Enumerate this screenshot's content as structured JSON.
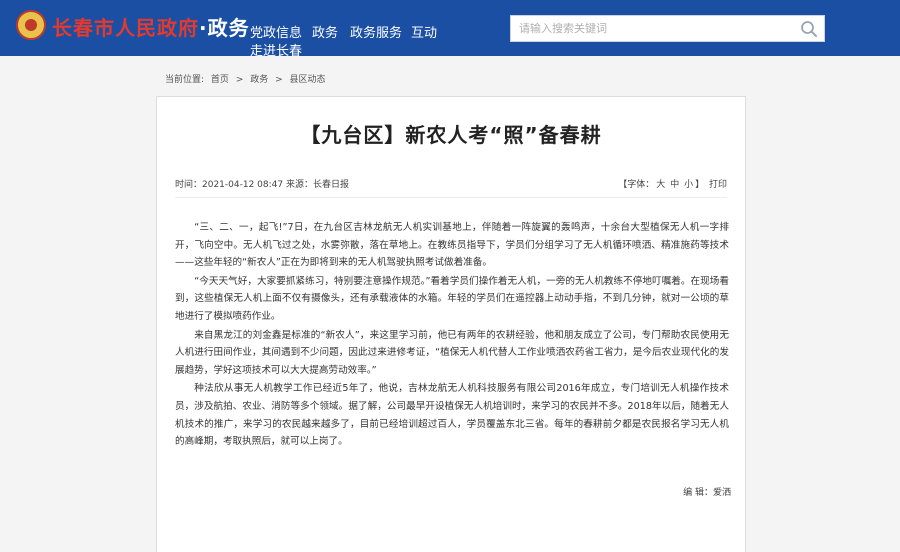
{
  "header": {
    "site_title": "长春市人民政府",
    "separator": "·",
    "subtitle": "政务",
    "nav_items": [
      "党政信息",
      "政务",
      "政务服务",
      "互动"
    ],
    "nav_second_line": "走进长春",
    "search_placeholder": "请输入搜索关键词",
    "icons": {
      "emblem": "national-emblem-icon",
      "search": "search-icon"
    },
    "colors": {
      "header_bg": "#1b4fa3",
      "title_red": "#e23a2e"
    }
  },
  "breadcrumb": {
    "label": "当前位置:",
    "items": [
      "首页",
      "政务",
      "县区动态"
    ],
    "sep": ">"
  },
  "article": {
    "title": "【九台区】新农人考“照”备春耕",
    "time": "时间：2021-04-12 08:47",
    "source": "来源：长春日报",
    "font_label": "【字体：",
    "font_sizes": [
      "大",
      "中",
      "小"
    ],
    "font_close": "】",
    "print_label": "打印",
    "paragraphs": [
      "“三、二、一，起飞!”7日，在九台区吉林龙航无人机实训基地上，伴随着一阵旋翼的轰鸣声，十余台大型植保无人机一字排开，飞向空中。无人机飞过之处，水雾弥散，落在草地上。在教练员指导下，学员们分组学习了无人机循环喷洒、精准施药等技术——这些年轻的“新农人”正在为即将到来的无人机驾驶执照考试做着准备。",
      "“今天天气好，大家要抓紧练习，特别要注意操作规范。”看着学员们操作着无人机，一旁的无人机教练不停地叮嘱着。在现场看到，这些植保无人机上面不仅有摄像头，还有承载液体的水箱。年轻的学员们在遥控器上动动手指，不到几分钟，就对一公顷的草地进行了模拟喷药作业。",
      "来自黑龙江的刘金鑫是标准的“新农人”，来这里学习前，他已有两年的农耕经验，他和朋友成立了公司，专门帮助农民使用无人机进行田间作业，其间遇到不少问题，因此过来进修考证，“植保无人机代替人工作业喷洒农药省工省力，是今后农业现代化的发展趋势，学好这项技术可以大大提高劳动效率。”",
      "种法欣从事无人机教学工作已经近5年了，他说，吉林龙航无人机科技服务有限公司2016年成立，专门培训无人机操作技术员，涉及航拍、农业、消防等多个领域。据了解，公司最早开设植保无人机培训时，来学习的农民并不多。2018年以后，随着无人机技术的推广，来学习的农民越来越多了，目前已经培训超过百人，学员覆盖东北三省。每年的春耕前夕都是农民报名学习无人机的高峰期，考取执照后，就可以上岗了。"
    ],
    "editor": "编 辑：爱洒"
  }
}
